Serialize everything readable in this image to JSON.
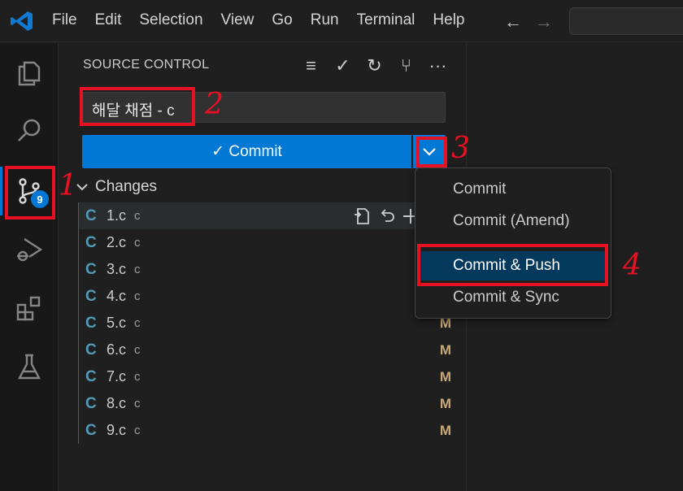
{
  "menu": [
    "File",
    "Edit",
    "Selection",
    "View",
    "Go",
    "Run",
    "Terminal",
    "Help"
  ],
  "nav": {
    "back": "←",
    "forward": "→"
  },
  "activity": {
    "badge_count": "9"
  },
  "source_control": {
    "title": "SOURCE CONTROL",
    "actions": [
      "≡",
      "✓",
      "↻",
      "⑂",
      "···"
    ],
    "message_value": "해달 채점 - c",
    "commit_label": "✓ Commit",
    "changes_label": "Changes",
    "files": [
      {
        "name": "1.c",
        "dir": "c",
        "status": ""
      },
      {
        "name": "2.c",
        "dir": "c",
        "status": ""
      },
      {
        "name": "3.c",
        "dir": "c",
        "status": ""
      },
      {
        "name": "4.c",
        "dir": "c",
        "status": ""
      },
      {
        "name": "5.c",
        "dir": "c",
        "status": "M"
      },
      {
        "name": "6.c",
        "dir": "c",
        "status": "M"
      },
      {
        "name": "7.c",
        "dir": "c",
        "status": "M"
      },
      {
        "name": "8.c",
        "dir": "c",
        "status": "M"
      },
      {
        "name": "9.c",
        "dir": "c",
        "status": "M"
      }
    ],
    "file_lang_icon": "C"
  },
  "dropdown": {
    "items": [
      "Commit",
      "Commit (Amend)",
      "Commit & Push",
      "Commit & Sync"
    ]
  },
  "annotations": [
    "1",
    "2",
    "3",
    "4"
  ]
}
